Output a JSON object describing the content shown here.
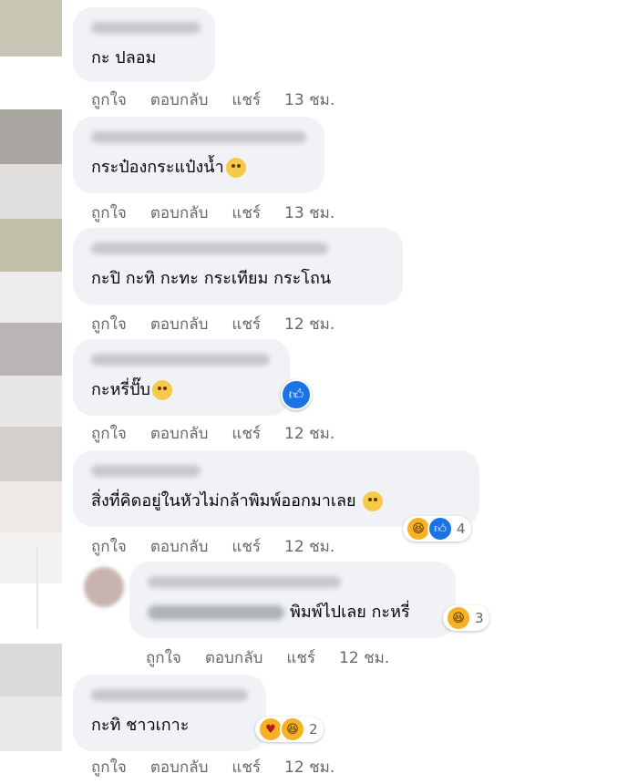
{
  "comments": [
    {
      "text": "กะ  ปลอม",
      "actions": [
        "ถูกใจ",
        "ตอบกลับ",
        "แชร์"
      ],
      "time": "13 ชม."
    },
    {
      "text": "กระป๋องกระแป๋งน้ำ",
      "emoji": "tired-face-emoji",
      "actions": [
        "ถูกใจ",
        "ตอบกลับ",
        "แชร์"
      ],
      "time": "13 ชม."
    },
    {
      "text": "กะปิ กะทิ กะทะ กระเทียม กระโถน",
      "actions": [
        "ถูกใจ",
        "ตอบกลับ",
        "แชร์"
      ],
      "time": "12 ชม."
    },
    {
      "text": "กะหรี่ปั๊บ",
      "emoji": "rolling-laugh-emoji",
      "reaction": "like",
      "actions": [
        "ถูกใจ",
        "ตอบกลับ",
        "แชร์"
      ],
      "time": "12 ชม."
    },
    {
      "text": "สิ่งที่คิดอยู่ในหัวไม่กล้าพิมพ์ออกมาเลย",
      "emoji": "sweat-smile-emoji",
      "reaction_count": "4",
      "actions": [
        "ถูกใจ",
        "ตอบกลับ",
        "แชร์"
      ],
      "time": "12 ชม."
    },
    {
      "text": "พิมพ์ไปเลย กะหรี่",
      "reaction_count": "3",
      "actions": [
        "ถูกใจ",
        "ตอบกลับ",
        "แชร์"
      ],
      "time": "12 ชม."
    },
    {
      "text": "กะทิ ชาวเกาะ",
      "reaction_count": "2",
      "actions": [
        "ถูกใจ",
        "ตอบกลับ",
        "แชร์"
      ],
      "time": "12 ชม."
    }
  ],
  "colors": {
    "bubble": "#f0f2f5",
    "like_blue": "#1b74e4",
    "meta_gray": "#65676b"
  }
}
